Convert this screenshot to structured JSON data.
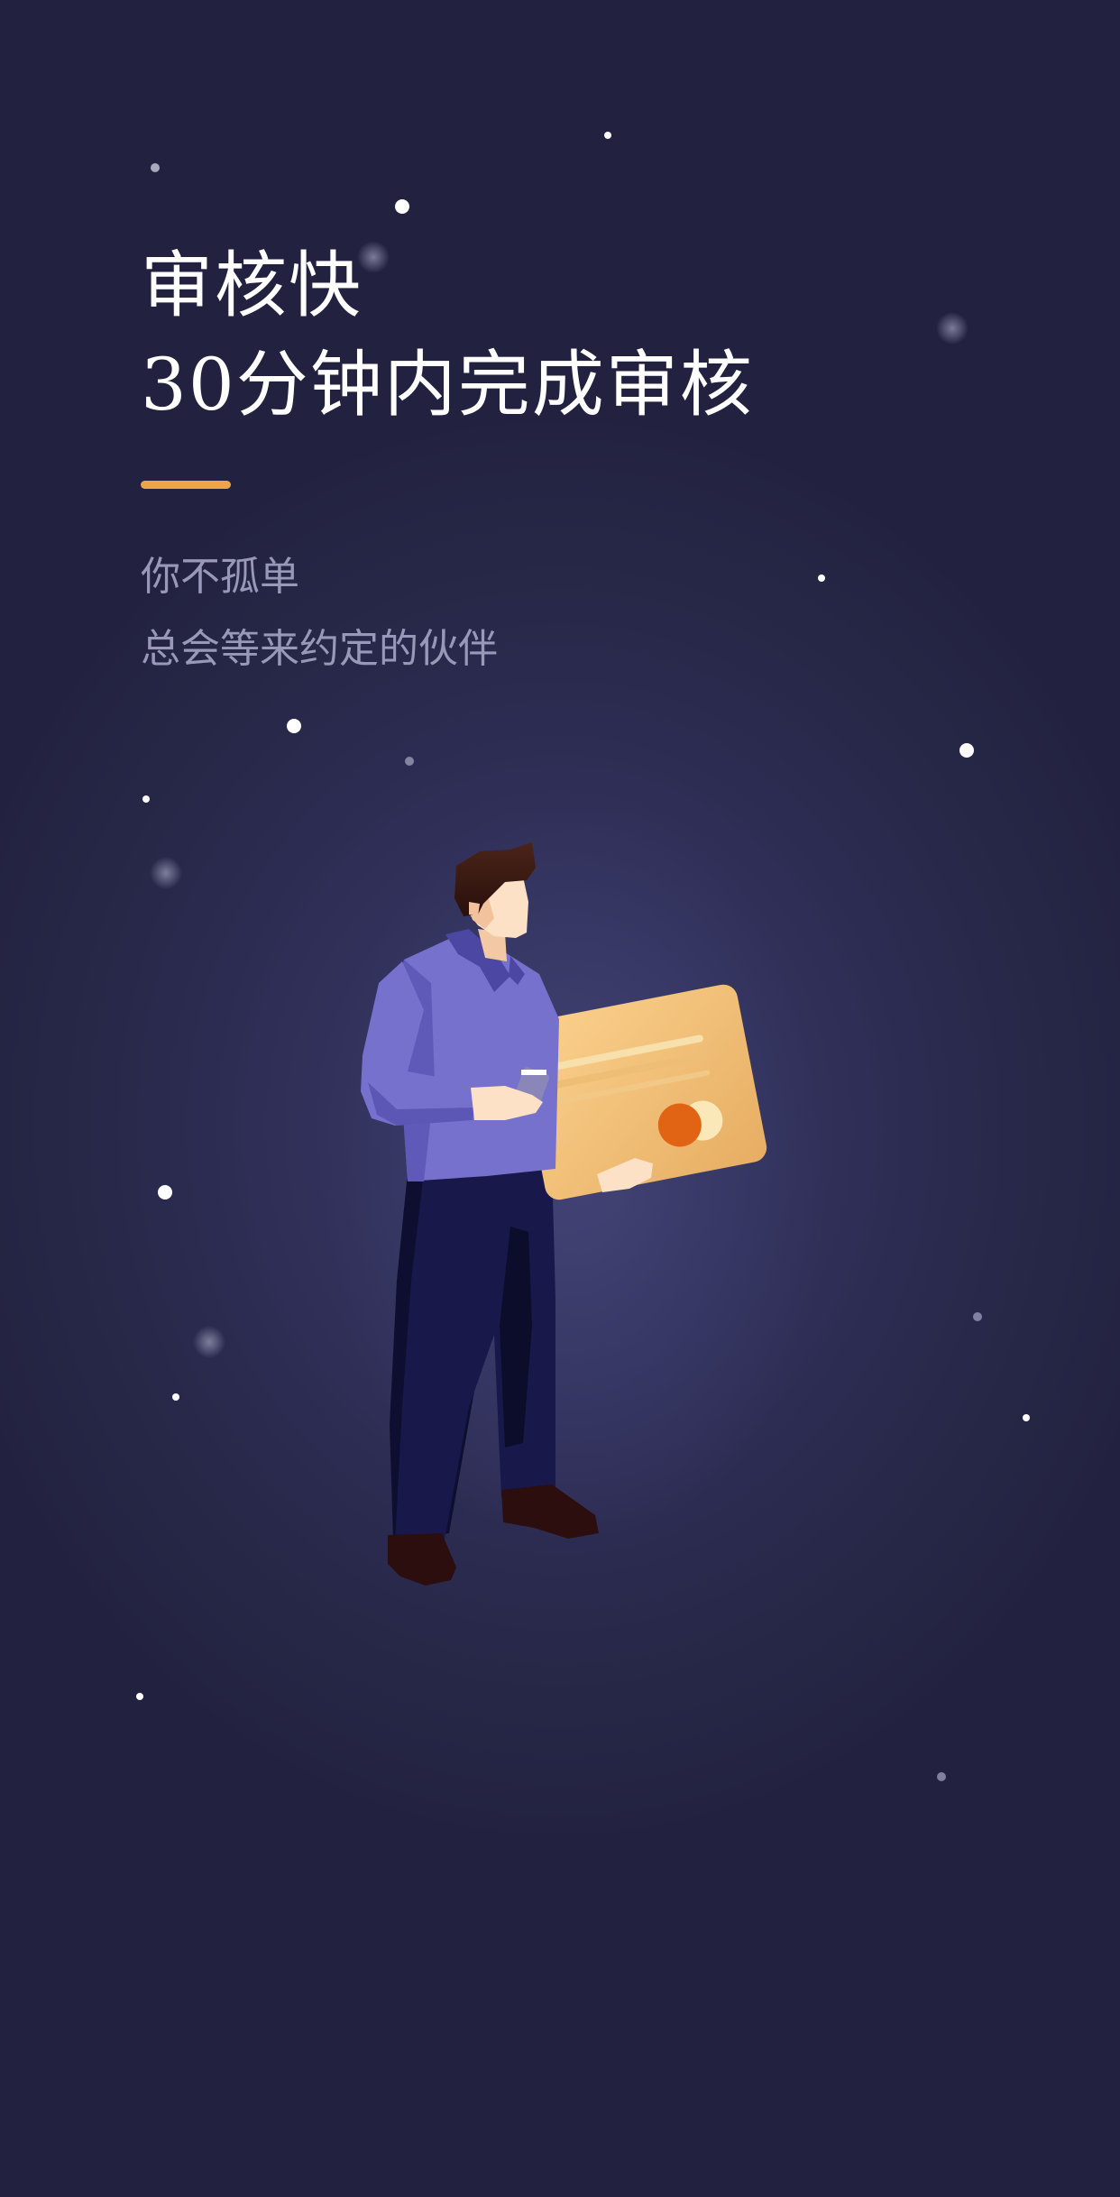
{
  "headline": {
    "line1": "审核快",
    "line2": "30分钟内完成审核"
  },
  "subtitle": {
    "line1": "你不孤单",
    "line2": "总会等来约定的伙伴"
  },
  "colors": {
    "background": "#2b2b50",
    "accent": "#f0a44a",
    "headline_text": "#ffffff",
    "subtitle_text": "#9898b8"
  },
  "illustration": {
    "subject": "person-holding-credit-card"
  }
}
